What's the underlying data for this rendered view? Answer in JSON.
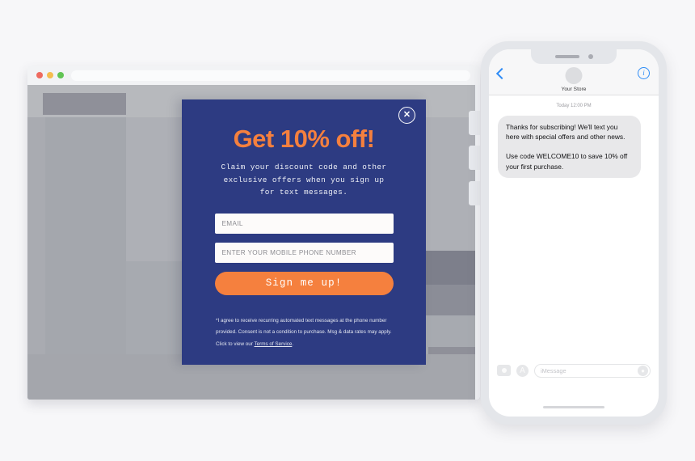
{
  "browser": {
    "traffic_lights": [
      "close-red",
      "minimize-yellow",
      "zoom-green"
    ],
    "address_bar_value": ""
  },
  "modal": {
    "close_label": "✕",
    "headline": "Get 10% off!",
    "subcopy": "Claim your discount code and other exclusive offers when you sign up for text messages.",
    "email_placeholder": "EMAIL",
    "email_value": "",
    "phone_placeholder": "ENTER YOUR MOBILE PHONE NUMBER",
    "phone_value": "",
    "cta_label": "Sign me up!",
    "fineprint_text": "*I agree to receive recurring automated text messages at the phone number provided. Consent is not a condition to purchase. Msg & data rates may apply. Click to view our ",
    "fineprint_link": "Terms of Service",
    "fineprint_end": ".",
    "colors": {
      "background": "#2d3b82",
      "accent": "#f5803e",
      "text": "#eceef5"
    }
  },
  "phone": {
    "header": {
      "contact_name": "Your Store",
      "back_icon": "chevron-left-icon",
      "info_icon": "info-icon",
      "avatar_icon": "avatar-placeholder"
    },
    "thread": {
      "timestamp": "Today 12:00 PM",
      "messages": [
        {
          "paragraphs": [
            "Thanks for subscribing! We'll text you here with special offers and other news.",
            "Use code WELCOME10 to save 10% off your first purchase."
          ]
        }
      ]
    },
    "input_bar": {
      "camera_icon": "camera-icon",
      "appstore_icon": "appstore-icon",
      "placeholder": "iMessage",
      "value": "",
      "mic_icon": "microphone-icon"
    }
  }
}
